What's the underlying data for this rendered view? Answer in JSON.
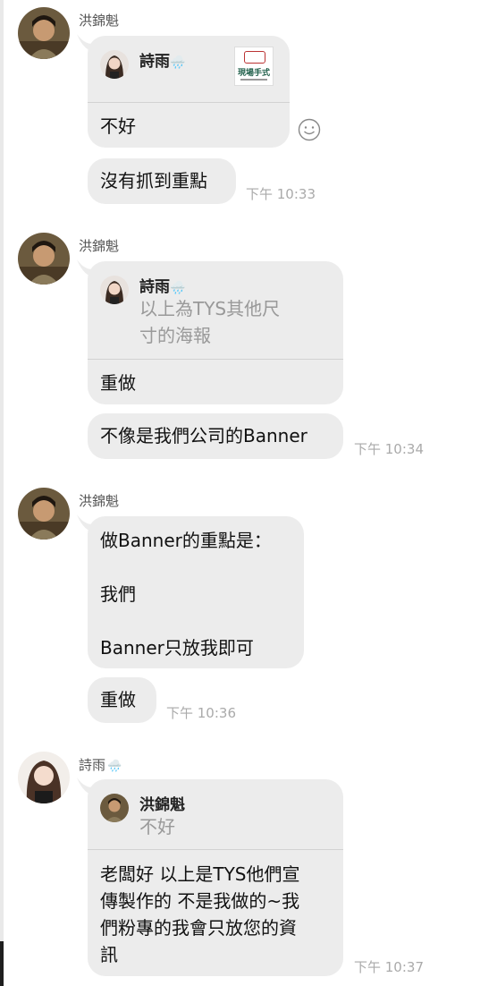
{
  "contacts": {
    "hong": {
      "name": "洪錦魁"
    },
    "shiyu": {
      "name": "詩雨",
      "emoji": "🌧️"
    }
  },
  "messages": [
    {
      "sender": "hong",
      "reply_to": {
        "name": "詩雨",
        "emoji": "🌧️",
        "thumbnail_text": "現場手式"
      },
      "text": "不好"
    },
    {
      "sender": "hong",
      "text": "沒有抓到重點",
      "time": "下午 10:33"
    },
    {
      "sender": "hong",
      "reply_to": {
        "name": "詩雨",
        "emoji": "🌧️",
        "snippet": "以上為TYS其他尺\n寸的海報"
      },
      "text": "重做"
    },
    {
      "sender": "hong",
      "text": "不像是我們公司的Banner",
      "time": "下午 10:34"
    },
    {
      "sender": "hong",
      "text": "做Banner的重點是：\n\n我們\n\nBanner只放我即可"
    },
    {
      "sender": "hong",
      "text": "重做",
      "time": "下午 10:36"
    },
    {
      "sender": "shiyu",
      "reply_to": {
        "name": "洪錦魁",
        "snippet": "不好"
      },
      "text": "老闆好 以上是TYS他們宣\n傳製作的 不是我做的~我\n們粉專的我會只放您的資\n訊",
      "time": "下午 10:37"
    }
  ]
}
